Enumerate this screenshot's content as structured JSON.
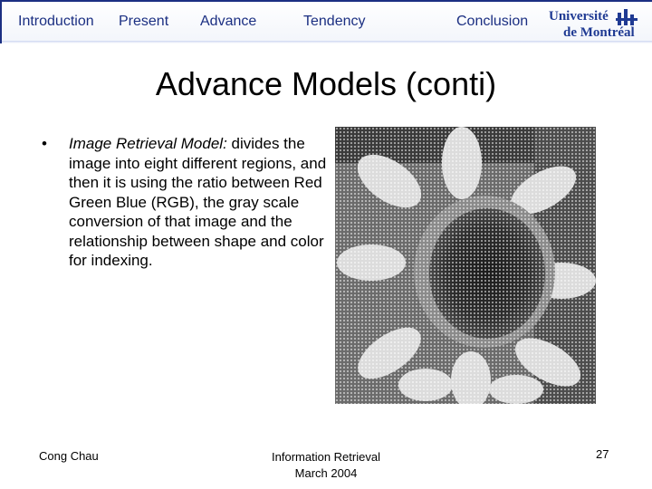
{
  "nav": {
    "items": [
      "Introduction",
      "Present",
      "Advance",
      "Tendency",
      "Conclusion"
    ]
  },
  "logo": {
    "line1": "Université",
    "line2": "de Montréal"
  },
  "slide": {
    "title": "Advance Models (conti)",
    "bullet": {
      "marker": "•",
      "lead": "Image Retrieval Model:",
      "body": " divides the image into eight different regions, and then it is using the ratio between Red Green Blue (RGB), the gray scale conversion of that image and the relationship between shape and color for indexing."
    }
  },
  "footer": {
    "author": "Cong Chau",
    "course": "Information Retrieval",
    "date": "March 2004",
    "page_number": "27"
  },
  "colors": {
    "nav_text": "#1b2f82",
    "logo": "#1f3a93"
  }
}
